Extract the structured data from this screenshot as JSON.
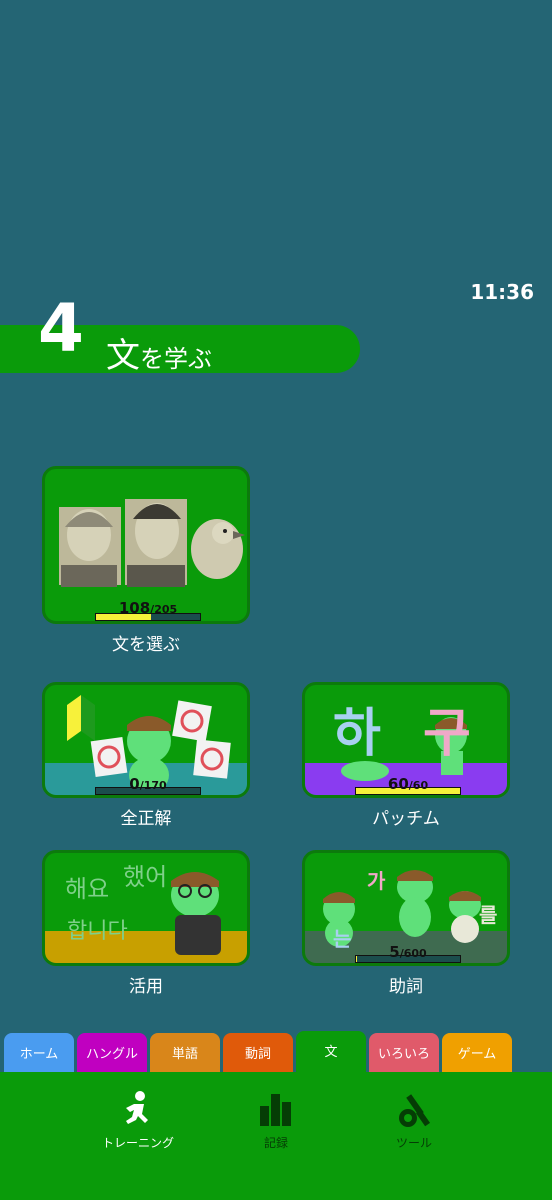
{
  "status": {
    "time": "11:36"
  },
  "section": {
    "number": "4",
    "title_kanji": "文",
    "title_rest": "を学ぶ"
  },
  "cards": [
    {
      "id": "select",
      "label": "文を選ぶ",
      "current": "108",
      "total": "205",
      "progress": 0.527,
      "band_color": "#0a9b0a"
    },
    {
      "id": "all-correct",
      "label": "全正解",
      "current": "0",
      "total": "170",
      "progress": 0.0,
      "band_color": "#2a9a9a"
    },
    {
      "id": "batchim",
      "label": "パッチム",
      "current": "60",
      "total": "60",
      "progress": 1.0,
      "band_color": "#8a3cf0",
      "hangul": [
        "하",
        "구"
      ]
    },
    {
      "id": "conjugation",
      "label": "活用",
      "band_color": "#c8a000",
      "hangul": [
        "해요",
        "했어",
        "합니다"
      ]
    },
    {
      "id": "particles",
      "label": "助詞",
      "current": "5",
      "total": "600",
      "progress": 0.008,
      "band_color": "#3f6b50",
      "hangul": [
        "가",
        "는",
        "를"
      ]
    }
  ],
  "tabs": [
    {
      "label": "ホーム",
      "color": "#4a9cf0"
    },
    {
      "label": "ハングル",
      "color": "#c000c0"
    },
    {
      "label": "単語",
      "color": "#d9861a"
    },
    {
      "label": "動詞",
      "color": "#e05a0a"
    },
    {
      "label": "文",
      "color": "#0a9b0a",
      "active": true
    },
    {
      "label": "いろいろ",
      "color": "#e05a6a"
    },
    {
      "label": "ゲーム",
      "color": "#f0a000"
    }
  ],
  "nav": [
    {
      "label": "トレーニング",
      "icon": "running-person-icon",
      "active": true
    },
    {
      "label": "記録",
      "icon": "bar-chart-icon",
      "active": false
    },
    {
      "label": "ツール",
      "icon": "tools-icon",
      "active": false
    }
  ]
}
